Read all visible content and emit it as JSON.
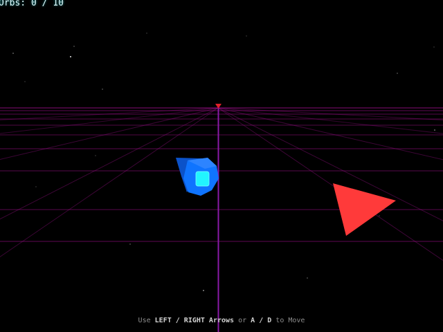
{
  "hud": {
    "orbs_label": "Orbs:",
    "orbs_collected": 0,
    "orbs_total": 10
  },
  "controls": {
    "use": "Use",
    "arrows_keys": "LEFT / RIGHT",
    "arrows": "Arrows",
    "or": "or",
    "ad_keys": "A / D",
    "to_move": "to Move"
  },
  "colors": {
    "background": "#000000",
    "grid": "#b0109a",
    "lane_line": "#8a1aa8",
    "lane_marker": "#e0202a",
    "player": "#0f74ff",
    "player_core": "#22f4ff",
    "obstacle": "#ff3a3a",
    "hud_text": "#e6fbff",
    "hint_text": "#8d8d8d"
  },
  "scene": {
    "player": "blue-ship",
    "obstacle": "red-triangle",
    "floor": "neon-grid"
  }
}
